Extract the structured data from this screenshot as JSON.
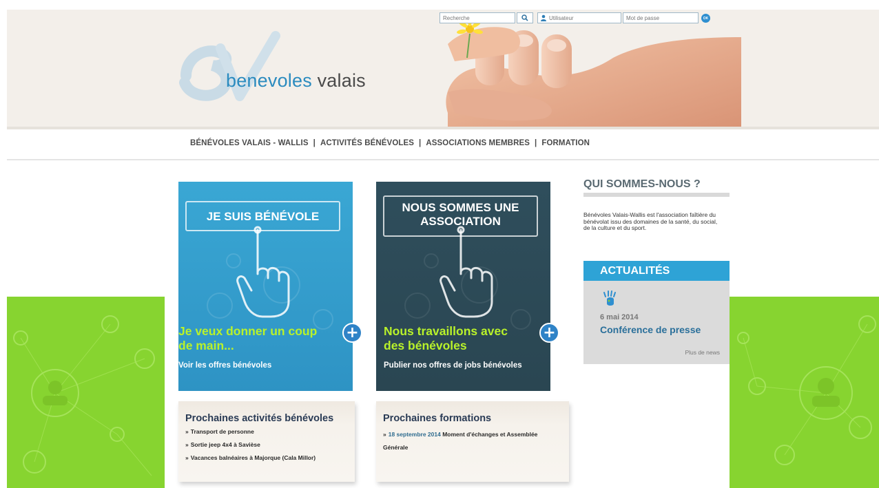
{
  "header": {
    "brand_part1": "benevoles",
    "brand_part2": "valais",
    "search_placeholder": "Recherche",
    "user_placeholder": "Utilisateur",
    "password_placeholder": "Mot de passe",
    "ok_label": "OK"
  },
  "nav": {
    "items": [
      {
        "label": "BÉNÉVOLES VALAIS - WALLIS"
      },
      {
        "label": "ACTIVITÉS BÉNÉVOLES"
      },
      {
        "label": "ASSOCIATIONS MEMBRES"
      },
      {
        "label": "FORMATION"
      }
    ],
    "separator": "|"
  },
  "tiles": [
    {
      "box_title": "JE SUIS BÉNÉVOLE",
      "headline_line1": "Je veux donner un coup",
      "headline_line2": "de main...",
      "link": "Voir les offres bénévoles"
    },
    {
      "box_title_line1": "NOUS SOMMES UNE",
      "box_title_line2": "ASSOCIATION",
      "headline_line1": "Nous travaillons avec",
      "headline_line2": "des bénévoles",
      "link": "Publier nos offres de jobs bénévoles"
    }
  ],
  "plus_symbol": "+",
  "activities": {
    "title": "Prochaines activités bénévoles",
    "arrow": "»",
    "items": [
      "Transport de personne",
      "Sortie jeep 4x4 à Savièse",
      "Vacances balnéaires à Majorque (Cala Millor)"
    ]
  },
  "formations": {
    "title": "Prochaines formations",
    "arrow": "»",
    "item_date": "18 septembre 2014",
    "item_text_line1": "Moment d'échanges et Assemblée",
    "item_text_line2": "Générale"
  },
  "about": {
    "title": "QUI SOMMES-NOUS ?",
    "text": "Bénévoles Valais-Wallis est l'association faîtière du bénévolat issu des domaines de la santé, du social, de la culture et du sport."
  },
  "news": {
    "title": "ACTUALITÉS",
    "date": "6 mai 2014",
    "headline": "Conférence de presse",
    "more": "Plus de news"
  },
  "colors": {
    "accent_blue": "#2ea3d6",
    "dark_teal": "#2f4e5c",
    "lime_green": "#87d430",
    "headline_green": "#b9f22a"
  }
}
